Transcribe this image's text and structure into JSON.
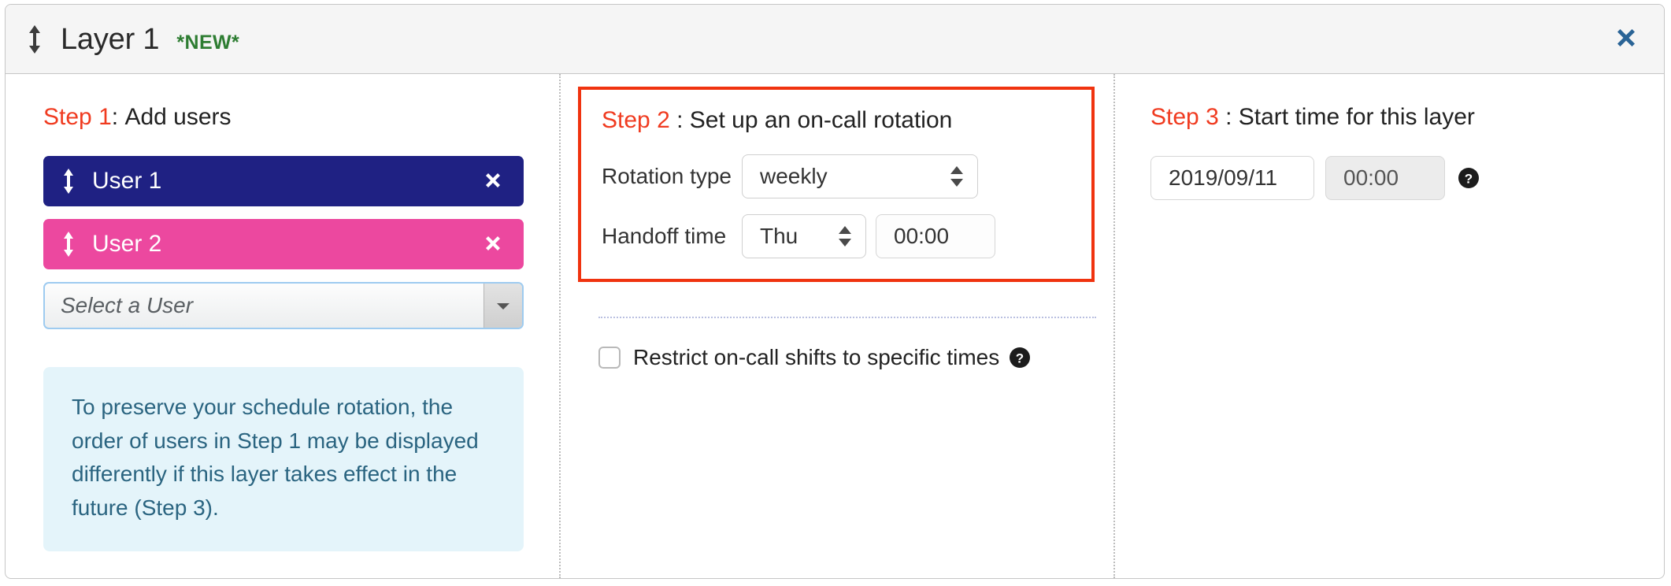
{
  "header": {
    "title": "Layer 1",
    "badge": "*NEW*",
    "drag_handle_icon": "updown-arrow-icon",
    "close_icon": "close-icon",
    "close_color": "#2a6496"
  },
  "colors": {
    "step_label": "#f03b20",
    "highlight_border": "#f0330f",
    "user1_chip": "#1f2183",
    "user2_chip": "#ec489f",
    "info_bg": "#e4f4fa",
    "info_text": "#2a6480",
    "badge_green": "#2e7d32"
  },
  "step1": {
    "step_label": "Step",
    "step_number": "1",
    "separator": ":",
    "title": "Add users",
    "users": [
      {
        "name": "User 1",
        "color": "#1f2183",
        "handle_icon": "updown-arrow-icon",
        "remove_icon": "close-icon"
      },
      {
        "name": "User 2",
        "color": "#ec489f",
        "handle_icon": "updown-arrow-icon",
        "remove_icon": "close-icon"
      }
    ],
    "user_select": {
      "placeholder": "Select a User",
      "value": "",
      "arrow_icon": "caret-down-icon"
    },
    "info_note": "To preserve your schedule rotation, the order of users in Step 1 may be displayed differently if this layer takes effect in the future (Step 3)."
  },
  "step2": {
    "step_label": "Step",
    "step_number": "2",
    "separator": ":",
    "title": "Set up an on-call rotation",
    "rotation_type": {
      "label": "Rotation type",
      "value": "weekly",
      "stepper_icon": "updown-stepper-icon"
    },
    "handoff_time": {
      "label": "Handoff time",
      "day_value": "Thu",
      "day_stepper_icon": "updown-stepper-icon",
      "time_value": "00:00"
    },
    "restrict": {
      "label": "Restrict on-call shifts to specific times",
      "checked": false,
      "help_icon": "help-circle-icon"
    }
  },
  "step3": {
    "step_label": "Step",
    "step_number": "3",
    "separator": ":",
    "title": "Start time for this layer",
    "date_value": "2019/09/11",
    "time_value": "00:00",
    "help_icon": "help-circle-icon"
  }
}
